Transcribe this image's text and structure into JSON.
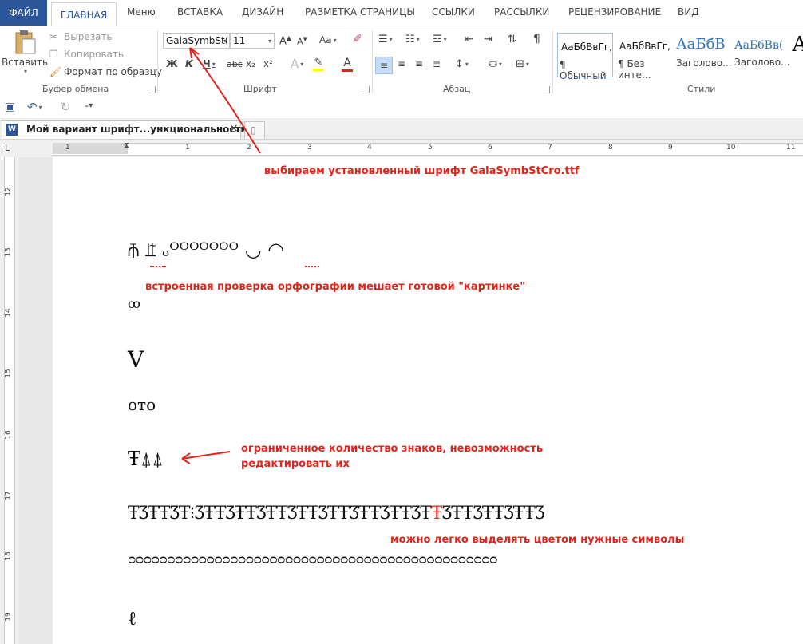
{
  "tabs": [
    "ФАЙЛ",
    "ГЛАВНАЯ",
    "Меню",
    "ВСТАВКА",
    "ДИЗАЙН",
    "РАЗМЕТКА СТРАНИЦЫ",
    "ССЫЛКИ",
    "РАССЫЛКИ",
    "РЕЦЕНЗИРОВАНИЕ",
    "ВИД"
  ],
  "clipboard": {
    "paste": "Вставить",
    "cut": "Вырезать",
    "copy": "Копировать",
    "format_painter": "Формат по образцу",
    "group": "Буфер обмена"
  },
  "font": {
    "name": "GalaSymbSt(",
    "size": "11",
    "change_case": "Aa",
    "bold": "Ж",
    "italic": "К",
    "underline": "Ч",
    "strike": "abc",
    "sub": "x₂",
    "sup": "x²",
    "color_letter": "A",
    "group": "Шрифт"
  },
  "paragraph": {
    "group": "Абзац"
  },
  "styles": {
    "items": [
      {
        "sample": "АаБбВвГг,",
        "name": "¶ Обычный"
      },
      {
        "sample": "АаБбВвГг,",
        "name": "¶ Без инте..."
      },
      {
        "sample": "АаБбВ",
        "name": "Заголово..."
      },
      {
        "sample": "АаБбВв(",
        "name": "Заголово..."
      },
      {
        "sample": "А",
        "name": ""
      }
    ],
    "group": "Стили"
  },
  "document_tab": {
    "title": "Мой вариант шрифт...ункциональности] *",
    "close": "×"
  },
  "hruler": [
    "1",
    "1",
    "2",
    "3",
    "4",
    "5",
    "6",
    "7",
    "8",
    "9",
    "10",
    "11"
  ],
  "vruler": [
    "12",
    "13",
    "14",
    "15",
    "16",
    "17",
    "18",
    "19"
  ],
  "annotations": {
    "font_note": "выбираем установленный шрифт GalaSymbStCro.ttf",
    "spelling_note": "встроенная проверка орфографии мешает готовой \"картинке\"",
    "limit_note_1": "ограниченное количество знаков, невозможность",
    "limit_note_2": "редактировать их",
    "color_note": "можно легко выделять цветом нужные символы"
  },
  "symbols": {
    "row1": "⫚ ⫫̃ ₒᴼᴼᴼᴼᴼᴼᴼ ◡ ◠",
    "row2": "ꝏ",
    "row3": "V",
    "row4": "ᴏᴛᴏ",
    "row5": "Ŧ⍋⍋",
    "row6_a": "ŦƷŦŦƷŦ⁝ƷŦŦƷŦŦƷŦŦƷŦŦƷŦŦƷŦŦƷŦŦƷŦ",
    "row6_red": "Ŧ",
    "row6_b": "ƷŦŦƷŦŦƷŦŦƷ",
    "row7": "ᴑᴑᴑᴑᴑᴑᴑᴑᴑᴑᴑᴑᴑᴑᴑᴑᴑᴑᴑᴑᴑᴑᴑᴑᴑᴑᴑᴑᴑᴑᴑᴑᴑᴑᴑᴑᴑᴑᴑᴑᴑᴑᴑᴑᴑᴑᴑ",
    "row8": "ℓ"
  },
  "colors": {
    "accent": "#2b579a",
    "annotation": "#e2231a"
  }
}
